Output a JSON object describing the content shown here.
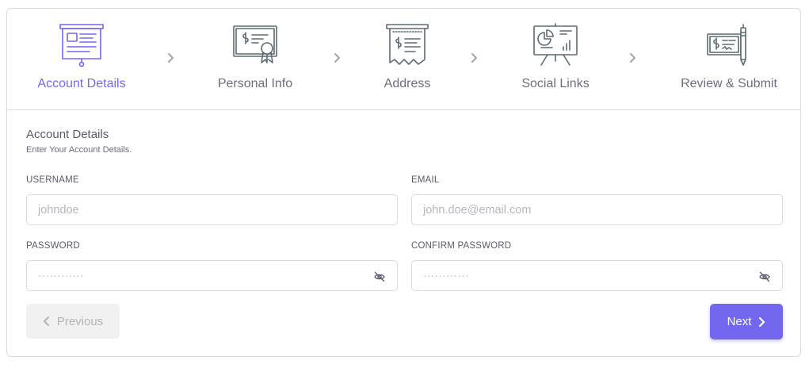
{
  "colors": {
    "accent": "#7367f0",
    "icon_inactive": "#5d6b72",
    "border": "#dbdade"
  },
  "steps": [
    {
      "label": "Account Details",
      "icon": "presentation-board-icon",
      "active": true
    },
    {
      "label": "Personal Info",
      "icon": "certificate-icon",
      "active": false
    },
    {
      "label": "Address",
      "icon": "receipt-icon",
      "active": false
    },
    {
      "label": "Social Links",
      "icon": "chart-presentation-icon",
      "active": false
    },
    {
      "label": "Review & Submit",
      "icon": "check-pen-icon",
      "active": false
    }
  ],
  "section": {
    "title": "Account Details",
    "subtitle": "Enter Your Account Details."
  },
  "fields": {
    "username": {
      "label": "USERNAME",
      "placeholder": "johndoe"
    },
    "email": {
      "label": "EMAIL",
      "placeholder": "john.doe@email.com"
    },
    "password": {
      "label": "PASSWORD",
      "placeholder": "············"
    },
    "confirm_password": {
      "label": "CONFIRM PASSWORD",
      "placeholder": "············"
    }
  },
  "buttons": {
    "previous": "Previous",
    "next": "Next"
  }
}
